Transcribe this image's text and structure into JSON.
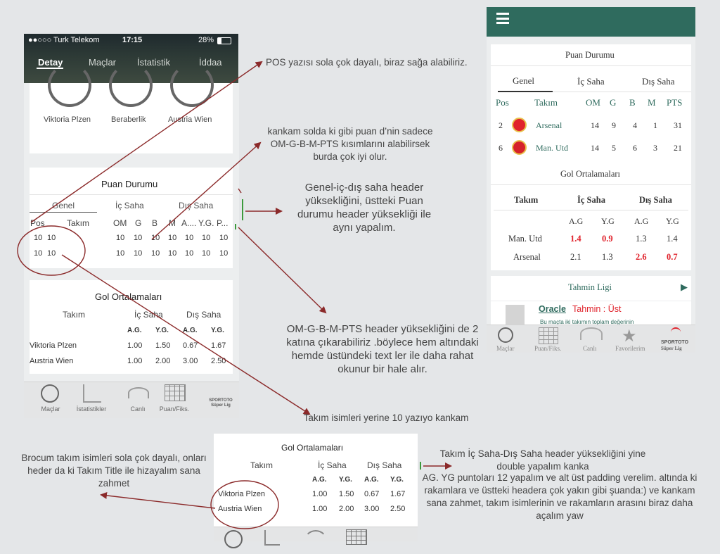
{
  "left_phone": {
    "status": {
      "carrier": "●●○○○ Turk Telekom",
      "time": "17:15",
      "battery": "28%"
    },
    "tabs": [
      "Detay",
      "Maçlar",
      "İstatistik",
      "İddaa"
    ],
    "circle_labels": [
      "Viktoria Plzen",
      "Beraberlik",
      "Austria Wien"
    ],
    "puan": {
      "title": "Puan Durumu",
      "tabs": [
        "Genel",
        "İç Saha",
        "Dış Saha"
      ],
      "cols": [
        "Pos",
        "Takım",
        "OM",
        "G",
        "B",
        "M",
        "A....",
        "Y.G.",
        "P..."
      ],
      "rows": [
        [
          "10",
          "10",
          "10",
          "10",
          "10",
          "10",
          "10",
          "10",
          "10"
        ],
        [
          "10",
          "10",
          "10",
          "10",
          "10",
          "10",
          "10",
          "10",
          "10"
        ]
      ]
    },
    "gol": {
      "title": "Gol Ortalamaları",
      "headers": [
        "Takım",
        "İç Saha",
        "Dış Saha"
      ],
      "sub": [
        "A.G.",
        "Y.G.",
        "A.G.",
        "Y.G."
      ],
      "rows": [
        {
          "team": "Viktoria Plzen",
          "vals": [
            "1.00",
            "1.50",
            "0.67",
            "1.67"
          ]
        },
        {
          "team": "Austria Wien",
          "vals": [
            "1.00",
            "2.00",
            "3.00",
            "2.50"
          ]
        }
      ]
    },
    "bottom_nav": [
      "Maçlar",
      "İstatistikler",
      "Canlı",
      "Puan/Fiks.",
      "SPORTOTO Süper Lig"
    ]
  },
  "notes": [
    "POS  yazısı sola çok dayalı, biraz sağa alabiliriz.",
    "kankam solda ki gibi puan d’nin sadece OM-G-B-M-PTS kısımlarını alabilirsek burda çok iyi olur.",
    "Genel-iç-dış saha header yüksekliğini, üstteki Puan durumu header yüksekliği ile aynı yapalım.",
    "OM-G-B-M-PTS header yüksekliğini de 2 katına çıkarabiliriz .böylece hem altındaki hemde üstündeki text ler ile daha rahat okunur bir hale alır.",
    "Takım isimleri yerine 10 yazıyo kankam",
    "Brocum takım isimleri sola çok dayalı, onları heder da ki Takım Title ile hizayalım sana zahmet",
    "Takım İç Saha-Dış Saha header yüksekliğini yine double yapalım kanka",
    "AG. YG  puntoları 12 yapalım ve alt üst padding verelim. altında ki rakamlara ve üstteki headera çok yakın gibi şuanda:) ve kankam sana zahmet, takım isimlerinin ve rakamların arasını biraz daha açalım yaw"
  ],
  "right_phone": {
    "puan": {
      "title": "Puan Durumu",
      "tabs": [
        "Genel",
        "İç Saha",
        "Dış Saha"
      ],
      "cols": [
        "Pos",
        "Takım",
        "OM",
        "G",
        "B",
        "M",
        "PTS"
      ],
      "rows": [
        {
          "pos": "2",
          "team": "Arsenal",
          "om": "14",
          "g": "9",
          "b": "4",
          "m": "1",
          "pts": "31"
        },
        {
          "pos": "6",
          "team": "Man. Utd",
          "om": "14",
          "g": "5",
          "b": "6",
          "m": "3",
          "pts": "21"
        }
      ]
    },
    "gol": {
      "title": "Gol Ortalamaları",
      "headers": [
        "Takım",
        "İç Saha",
        "Dış Saha"
      ],
      "sub": [
        "A.G",
        "Y.G",
        "A.G",
        "Y.G"
      ],
      "rows": [
        {
          "team": "Man. Utd",
          "vals": [
            "1.4",
            "0.9",
            "1.3",
            "1.4"
          ]
        },
        {
          "team": "Arsenal",
          "vals": [
            "2.1",
            "1.3",
            "2.6",
            "0.7"
          ]
        }
      ]
    },
    "tahmin": {
      "title": "Tahmin Ligi",
      "user": "Oracle",
      "text": "Tahmin : Üst",
      "sub": "Bu maçta iki takımın toplam değerinin"
    },
    "bottom_nav": [
      "Maçlar",
      "Puan/Fiks.",
      "Canlı",
      "Favorilerim",
      "Süper Lig"
    ],
    "logo_text": "SPORTOTO"
  },
  "bottom_crop": {
    "title": "Gol Ortalamaları",
    "headers": [
      "Takım",
      "İç Saha",
      "Dış Saha"
    ],
    "sub": [
      "A.G.",
      "Y.G.",
      "A.G.",
      "Y.G."
    ],
    "rows": [
      {
        "team": "Viktoria Plzen",
        "vals": [
          "1.00",
          "1.50",
          "0.67",
          "1.67"
        ]
      },
      {
        "team": "Austria Wien",
        "vals": [
          "1.00",
          "2.00",
          "3.00",
          "2.50"
        ]
      }
    ]
  },
  "colors": {
    "teal": "#2f6b5e",
    "annotation_red": "#8b2a2a",
    "highlight_red": "#e0232c",
    "green_marker": "#3c9a3c"
  }
}
